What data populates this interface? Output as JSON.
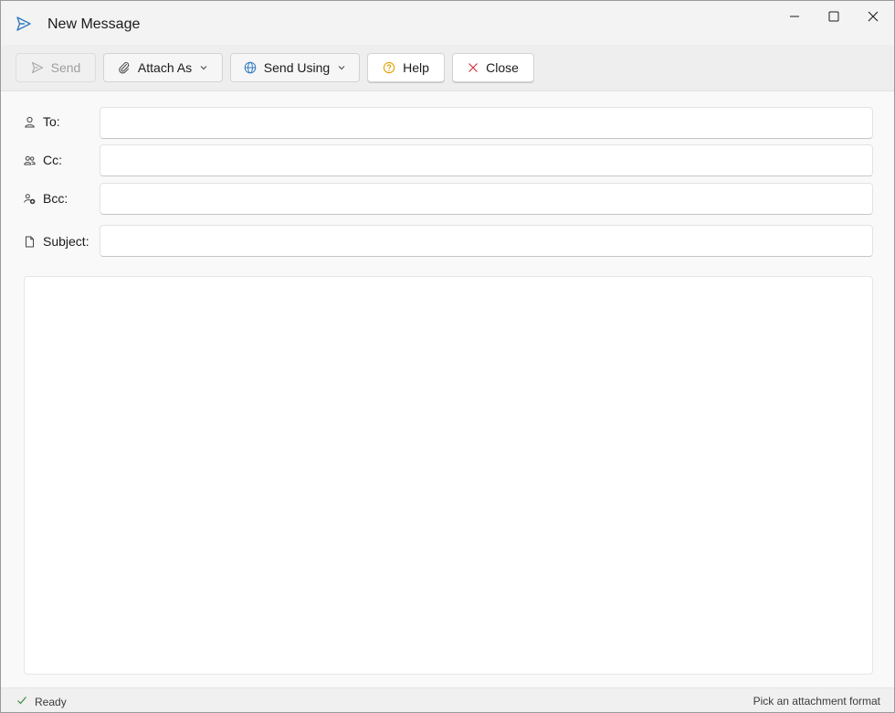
{
  "window": {
    "title": "New Message",
    "controls": [
      "minimize-icon",
      "maximize-icon",
      "close-icon"
    ]
  },
  "toolbar": {
    "send_label": "Send",
    "attach_as_label": "Attach As",
    "send_using_label": "Send Using",
    "help_label": "Help",
    "close_label": "Close"
  },
  "fields": {
    "to_label": "To:",
    "cc_label": "Cc:",
    "bcc_label": "Bcc:",
    "subject_label": "Subject:",
    "to_value": "",
    "cc_value": "",
    "bcc_value": "",
    "subject_value": ""
  },
  "body": {
    "value": ""
  },
  "status": {
    "left_text": "Ready",
    "right_text": "Pick an attachment format"
  },
  "colors": {
    "accent": "#2f7bbf",
    "help_icon": "#e0a100",
    "close_icon": "#d13438",
    "ready_check": "#3c8a3c"
  }
}
